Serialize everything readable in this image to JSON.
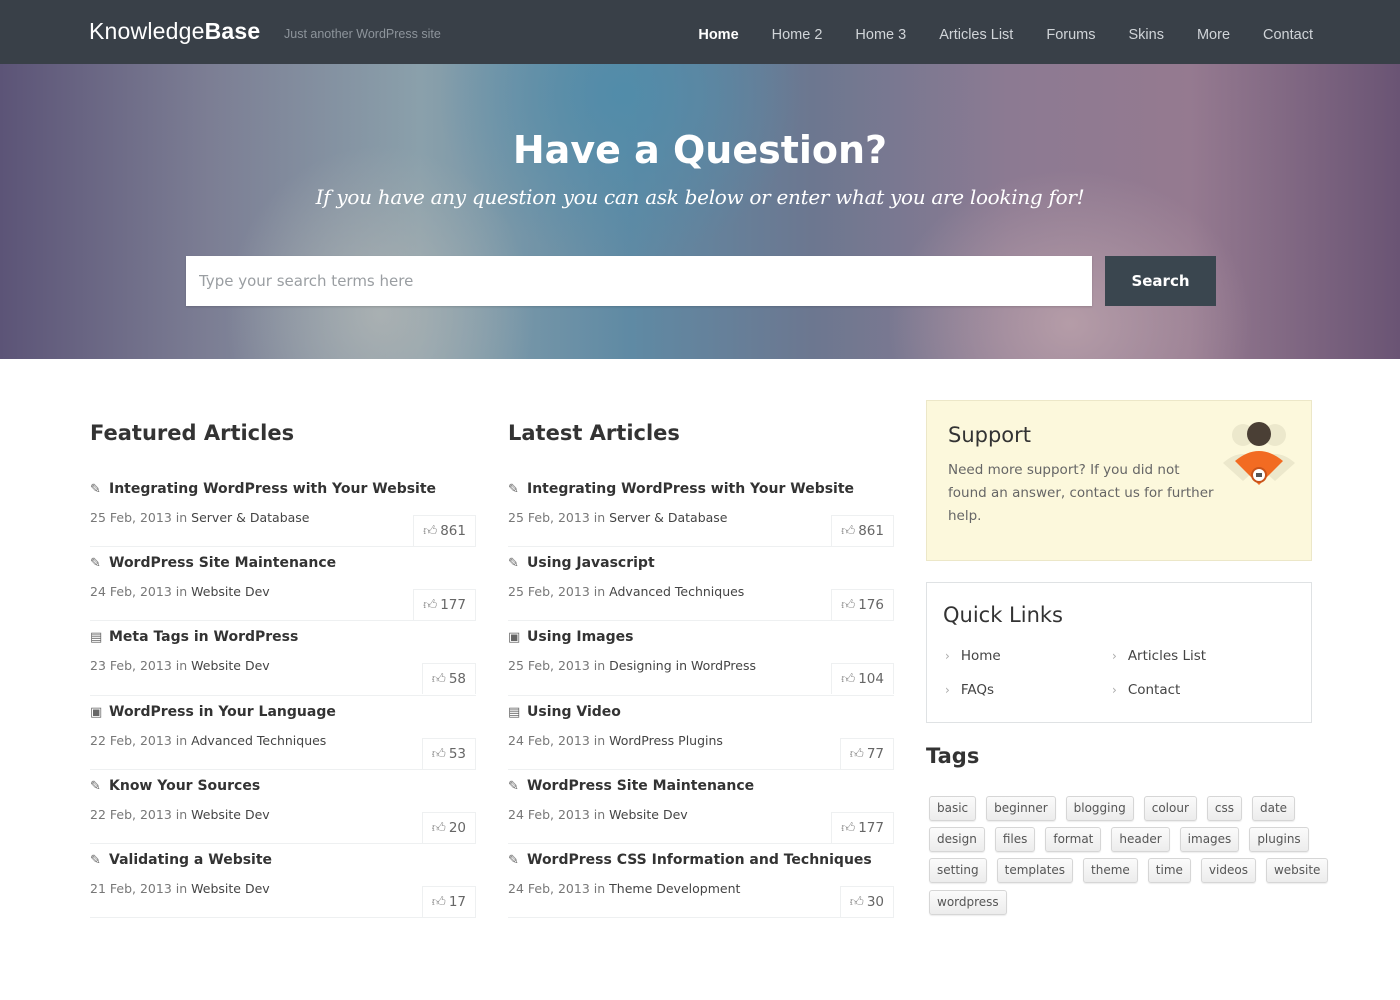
{
  "header": {
    "logo_light": "Knowledge",
    "logo_bold": "Base",
    "tagline": "Just another WordPress site",
    "nav": [
      {
        "label": "Home",
        "active": true
      },
      {
        "label": "Home 2"
      },
      {
        "label": "Home 3"
      },
      {
        "label": "Articles List"
      },
      {
        "label": "Forums"
      },
      {
        "label": "Skins"
      },
      {
        "label": "More"
      },
      {
        "label": "Contact"
      }
    ]
  },
  "hero": {
    "title": "Have a Question?",
    "subtitle": "If you have any question you can ask below or enter what you are looking for!",
    "search_placeholder": "Type your search terms here",
    "search_value": "",
    "search_button": "Search"
  },
  "featured": {
    "title": "Featured Articles",
    "in_label": "in",
    "articles": [
      {
        "icon": "edit-icon",
        "title": "Integrating WordPress with Your Website",
        "date": "25 Feb, 2013",
        "category": "Server & Database",
        "likes": "861"
      },
      {
        "icon": "edit-icon",
        "title": "WordPress Site Maintenance",
        "date": "24 Feb, 2013",
        "category": "Website Dev",
        "likes": "177"
      },
      {
        "icon": "film-icon",
        "title": "Meta Tags in WordPress",
        "date": "23 Feb, 2013",
        "category": "Website Dev",
        "likes": "58"
      },
      {
        "icon": "image-icon",
        "title": "WordPress in Your Language",
        "date": "22 Feb, 2013",
        "category": "Advanced Techniques",
        "likes": "53"
      },
      {
        "icon": "edit-icon",
        "title": "Know Your Sources",
        "date": "22 Feb, 2013",
        "category": "Website Dev",
        "likes": "20"
      },
      {
        "icon": "edit-icon",
        "title": "Validating a Website",
        "date": "21 Feb, 2013",
        "category": "Website Dev",
        "likes": "17"
      }
    ]
  },
  "latest": {
    "title": "Latest Articles",
    "in_label": "in",
    "articles": [
      {
        "icon": "edit-icon",
        "title": "Integrating WordPress with Your Website",
        "date": "25 Feb, 2013",
        "category": "Server & Database",
        "likes": "861"
      },
      {
        "icon": "edit-icon",
        "title": "Using Javascript",
        "date": "25 Feb, 2013",
        "category": "Advanced Techniques",
        "likes": "176"
      },
      {
        "icon": "image-icon",
        "title": "Using Images",
        "date": "25 Feb, 2013",
        "category": "Designing in WordPress",
        "likes": "104"
      },
      {
        "icon": "film-icon",
        "title": "Using Video",
        "date": "24 Feb, 2013",
        "category": "WordPress Plugins",
        "likes": "77"
      },
      {
        "icon": "edit-icon",
        "title": "WordPress Site Maintenance",
        "date": "24 Feb, 2013",
        "category": "Website Dev",
        "likes": "177"
      },
      {
        "icon": "edit-icon",
        "title": "WordPress CSS Information and Techniques",
        "date": "24 Feb, 2013",
        "category": "Theme Development",
        "likes": "30"
      }
    ]
  },
  "support": {
    "title": "Support",
    "text": "Need more support? If you did not found an answer, contact us for further help."
  },
  "quick_links": {
    "title": "Quick Links",
    "items": [
      "Home",
      "Articles List",
      "FAQs",
      "Contact"
    ]
  },
  "tags": {
    "title": "Tags",
    "items": [
      "basic",
      "beginner",
      "blogging",
      "colour",
      "css",
      "date",
      "design",
      "files",
      "format",
      "header",
      "images",
      "plugins",
      "setting",
      "templates",
      "theme",
      "time",
      "videos",
      "website",
      "wordpress"
    ]
  },
  "colors": {
    "header_bg": "#394048",
    "search_button_bg": "#3a464f",
    "support_bg": "#fcf8dc",
    "support_accent": "#f26b22"
  }
}
